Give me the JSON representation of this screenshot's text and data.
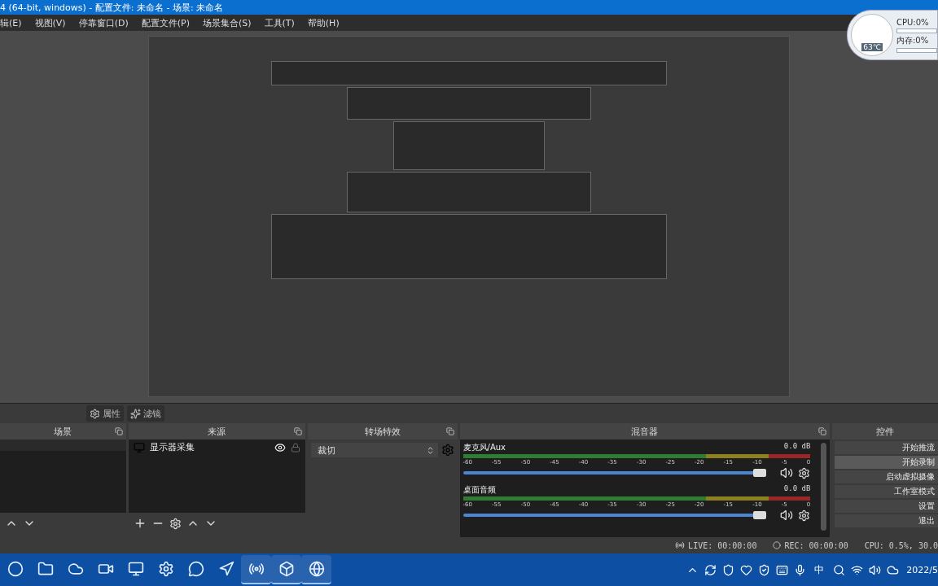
{
  "window": {
    "title": "4 (64-bit, windows) - 配置文件: 未命名 - 场景: 未命名"
  },
  "menu": [
    "辑(E)",
    "视图(V)",
    "停靠窗口(D)",
    "配置文件(P)",
    "场景集合(S)",
    "工具(T)",
    "帮助(H)"
  ],
  "gauge": {
    "temperature": "63℃",
    "cpu": "CPU:0%",
    "memory": "内存:0%"
  },
  "source_toolbar": [
    {
      "kind": "gear",
      "label": "属性"
    },
    {
      "kind": "filter",
      "label": "滤镜"
    }
  ],
  "scenes": {
    "title": "场景"
  },
  "sources": {
    "title": "来源",
    "items": [
      {
        "name": "显示器采集",
        "visible": true,
        "locked": false
      }
    ]
  },
  "transitions": {
    "title": "转场特效",
    "value": "裁切"
  },
  "mixer": {
    "title": "混音器",
    "channels": [
      {
        "name": "麦克风/Aux",
        "reading": "0.0 dB",
        "level": 0.98,
        "muted": false,
        "ticks": [
          "-60",
          "-55",
          "-50",
          "-45",
          "-40",
          "-35",
          "-30",
          "-25",
          "-20",
          "-15",
          "-10",
          "-5",
          "0"
        ]
      },
      {
        "name": "桌面音频",
        "reading": "0.0 dB",
        "level": 0.98,
        "muted": false,
        "ticks": [
          "-60",
          "-55",
          "-50",
          "-45",
          "-40",
          "-35",
          "-30",
          "-25",
          "-20",
          "-15",
          "-10",
          "-5",
          "0"
        ]
      }
    ]
  },
  "controls": {
    "title": "控件",
    "buttons": [
      {
        "label": "开始推流",
        "hovered": false
      },
      {
        "label": "开始录制",
        "hovered": true
      },
      {
        "label": "启动虚拟摄像",
        "hovered": false
      },
      {
        "label": "工作室模式",
        "hovered": false
      },
      {
        "label": "设置",
        "hovered": false
      },
      {
        "label": "退出",
        "hovered": false
      }
    ]
  },
  "status": {
    "live": "LIVE: 00:00:00",
    "rec": "REC: 00:00:00",
    "cpu": "CPU: 0.5%, 30.0"
  },
  "taskbar": {
    "apps": [
      {
        "kind": "start",
        "running": false
      },
      {
        "kind": "explorer",
        "running": false
      },
      {
        "kind": "cloud",
        "running": false
      },
      {
        "kind": "video",
        "running": false
      },
      {
        "kind": "monitor",
        "running": false
      },
      {
        "kind": "settings",
        "running": false
      },
      {
        "kind": "chat",
        "running": false
      },
      {
        "kind": "pin",
        "running": false
      },
      {
        "kind": "obs",
        "running": true
      },
      {
        "kind": "vm",
        "running": true
      },
      {
        "kind": "globe",
        "running": true
      }
    ],
    "tray": [
      {
        "kind": "chevron"
      },
      {
        "kind": "sync"
      },
      {
        "kind": "shield"
      },
      {
        "kind": "heart"
      },
      {
        "kind": "shieldcheck"
      },
      {
        "kind": "keyboard"
      },
      {
        "kind": "mic"
      }
    ],
    "ime": "中",
    "tray2": [
      {
        "kind": "sogou"
      },
      {
        "kind": "wifi"
      },
      {
        "kind": "volume"
      },
      {
        "kind": "cloud"
      }
    ],
    "date": "2022/5"
  }
}
